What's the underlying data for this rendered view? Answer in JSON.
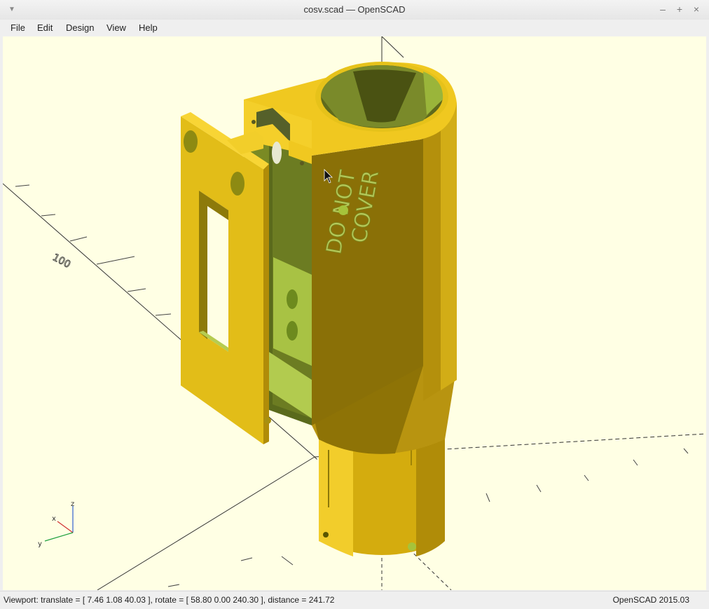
{
  "window": {
    "title": "cosv.scad — OpenSCAD",
    "controls": {
      "minimize": "–",
      "maximize": "+",
      "close": "×"
    }
  },
  "menu": {
    "items": [
      "File",
      "Edit",
      "Design",
      "View",
      "Help"
    ]
  },
  "viewport": {
    "background_color": "#ffffe4",
    "model_color": "#e8c21a",
    "model_engraving": [
      "DO NOT",
      "COVER"
    ],
    "axis_scale_label": "100",
    "axes_gizmo": {
      "x": "x",
      "y": "y",
      "z": "z"
    }
  },
  "status": {
    "viewport_info": "Viewport: translate = [ 7.46 1.08 40.03 ], rotate = [ 58.80 0.00 240.30 ], distance = 241.72",
    "version": "OpenSCAD 2015.03"
  }
}
